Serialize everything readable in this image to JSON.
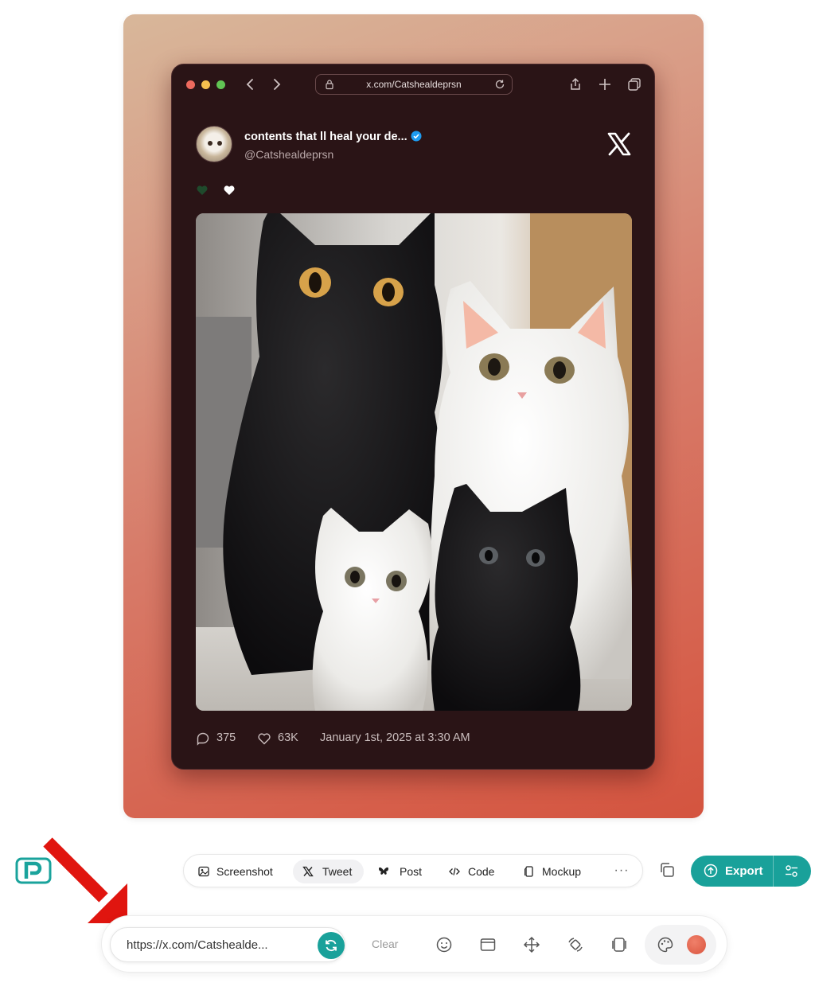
{
  "browser": {
    "url": "x.com/Catshealdeprsn"
  },
  "tweet": {
    "display_name": "contents that ll heal your de...",
    "handle": "@Catshealdeprsn",
    "replies": "375",
    "likes": "63K",
    "date": "January 1st, 2025 at 3:30 AM",
    "reaction_icons": [
      "green-heart-icon",
      "white-heart-icon"
    ]
  },
  "toolbar": {
    "tabs": [
      {
        "label": "Screenshot",
        "icon": "image-icon"
      },
      {
        "label": "Tweet",
        "icon": "x-icon"
      },
      {
        "label": "Post",
        "icon": "butterfly-icon"
      },
      {
        "label": "Code",
        "icon": "code-icon"
      },
      {
        "label": "Mockup",
        "icon": "phone-icon"
      }
    ],
    "active_tab": "Tweet",
    "more": "···",
    "export_label": "Export"
  },
  "bottombar": {
    "url_value": "https://x.com/Catshealde...",
    "clear_label": "Clear"
  },
  "colors": {
    "accent": "#19a19a",
    "canvas_gradient_start": "#d8b79a",
    "canvas_gradient_end": "#d4543f",
    "window_bg": "#2a1416",
    "color_dot": "#e0604a"
  }
}
